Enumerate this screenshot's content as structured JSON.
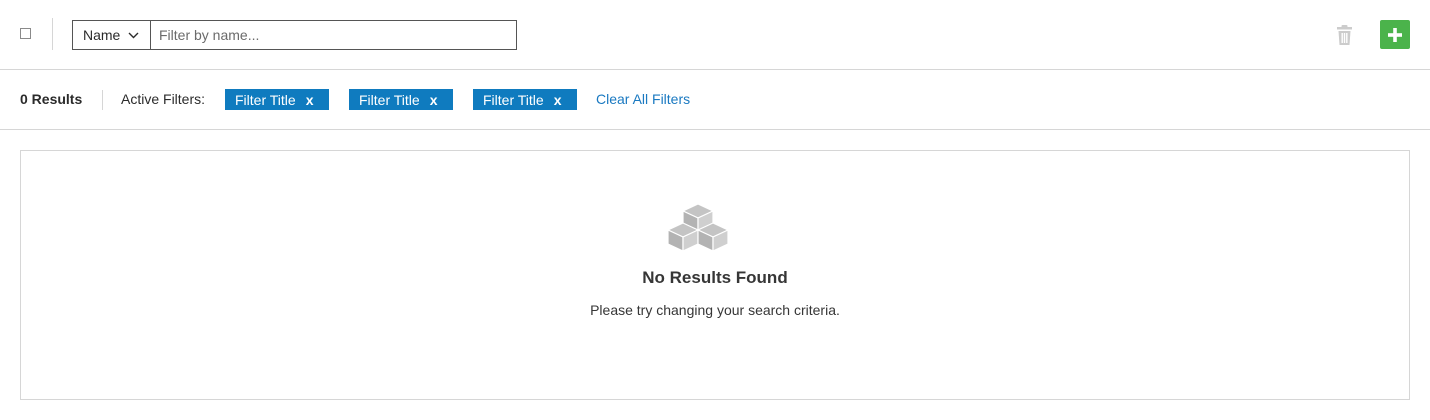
{
  "toolbar": {
    "filter_field": "Name",
    "filter_placeholder": "Filter by name...",
    "icons": {
      "dropdown": "chevron-down-icon",
      "delete": "trash-icon",
      "add": "plus-icon"
    },
    "colors": {
      "add_button": "#4bb34b",
      "trash": "#cccccc"
    }
  },
  "results": {
    "count_label": "0 Results",
    "active_filters_label": "Active Filters:",
    "chips": [
      {
        "label": "Filter Title",
        "remove": "x"
      },
      {
        "label": "Filter Title",
        "remove": "x"
      },
      {
        "label": "Filter Title",
        "remove": "x"
      }
    ],
    "clear_all_label": "Clear All Filters",
    "colors": {
      "chip": "#0f7bbf",
      "link": "#1a79c1"
    }
  },
  "empty_state": {
    "icon": "cubes-icon",
    "title": "No Results Found",
    "message": "Please try changing your search criteria."
  }
}
